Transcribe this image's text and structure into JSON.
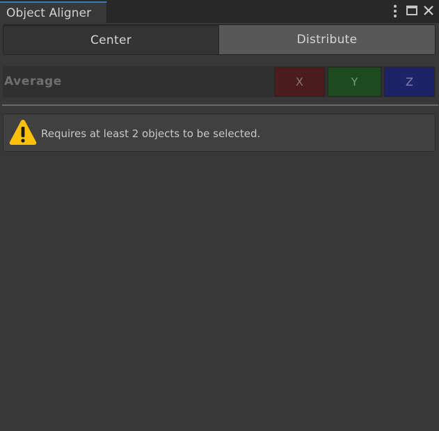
{
  "window": {
    "tab_title": "Object Aligner",
    "controls": [
      {
        "icon": "more-vertical-icon"
      },
      {
        "icon": "maximize-icon"
      },
      {
        "icon": "close-icon"
      }
    ]
  },
  "toolbar": {
    "items": [
      {
        "label": "Center",
        "selected": false
      },
      {
        "label": "Distribute",
        "selected": true
      }
    ]
  },
  "average_row": {
    "label": "Average",
    "axes": [
      {
        "label": "X",
        "color": "#4a1c1e"
      },
      {
        "label": "Y",
        "color": "#1e4a20"
      },
      {
        "label": "Z",
        "color": "#1e2266"
      }
    ]
  },
  "helpbox": {
    "icon": "warning-icon",
    "message": "Requires at least 2 objects to be selected."
  },
  "colors": {
    "background": "#383838",
    "tab_accent": "#3a79bb",
    "warning": "#ffc107"
  }
}
